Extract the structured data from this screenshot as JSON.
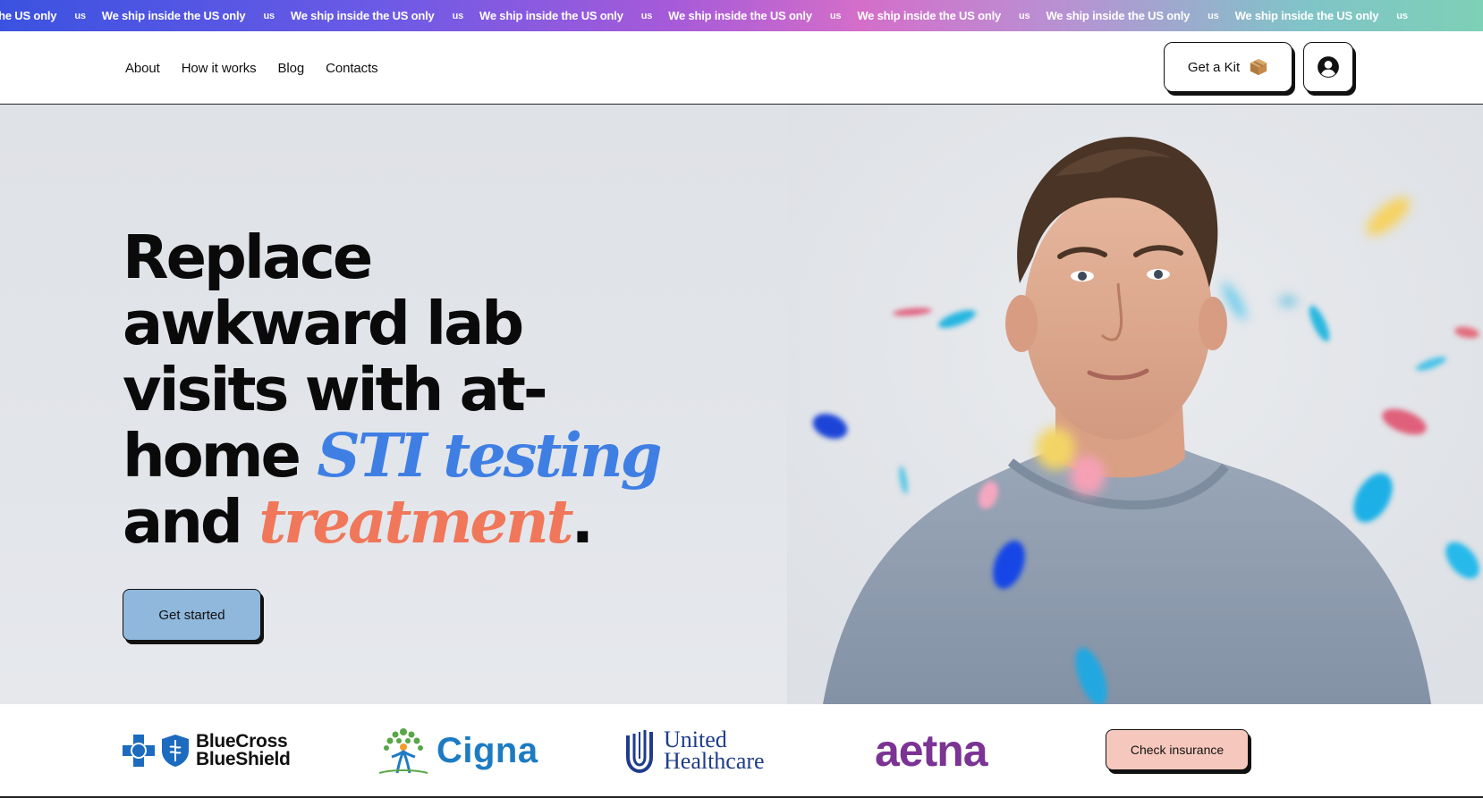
{
  "ticker": {
    "message": "We ship inside the US only",
    "lead_fragment": "the US only",
    "tag": "us",
    "colors": [
      "#3b52e0",
      "#a55ad9",
      "#d46ec9",
      "#7ed0b6"
    ]
  },
  "header": {
    "nav": [
      "About",
      "How it works",
      "Blog",
      "Contacts"
    ],
    "kit_button": {
      "label": "Get a Kit",
      "icon": "package-box-icon"
    },
    "account_button": {
      "icon": "user-circle-icon"
    }
  },
  "hero": {
    "title_line1": "Replace",
    "title_line2": "awkward lab",
    "title_line3": "visits with at-",
    "title_line4_plain": "home ",
    "title_line4_em": "STI testing",
    "title_line5_plain": "and ",
    "title_line5_em": "treatment",
    "title_line5_end": ".",
    "cta_label": "Get started",
    "accent_blue": "#3f7fe4",
    "accent_orange": "#f0775a",
    "cta_color": "#8fb8dc"
  },
  "insurance": {
    "bcbs_line1": "BlueCross",
    "bcbs_line2": "BlueShield",
    "cigna": "Cigna",
    "uhc_line1": "United",
    "uhc_line2": "Healthcare",
    "aetna": "aetna",
    "check_label": "Check insurance",
    "check_color": "#f6c8bd"
  }
}
